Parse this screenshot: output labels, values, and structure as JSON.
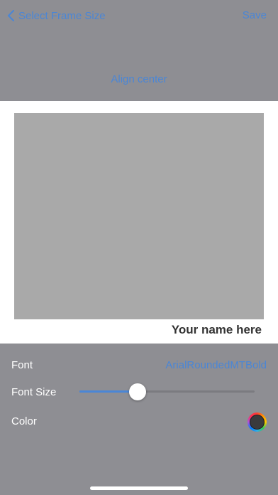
{
  "nav": {
    "back_label": "Select Frame Size",
    "save_label": "Save",
    "align_label": "Align center"
  },
  "canvas": {
    "caption": "Your name here"
  },
  "settings": {
    "font_label": "Font",
    "font_value": "ArialRoundedMTBold",
    "font_size_label": "Font Size",
    "font_size_fraction": 0.33,
    "color_label": "Color",
    "color_value": "#3a3a3c"
  },
  "colors": {
    "accent": "#4a86d6",
    "background": "#8e8e93",
    "photo_placeholder": "#a9a9a9"
  },
  "icons": {
    "back": "chevron-left-icon",
    "color": "color-wheel-icon"
  }
}
